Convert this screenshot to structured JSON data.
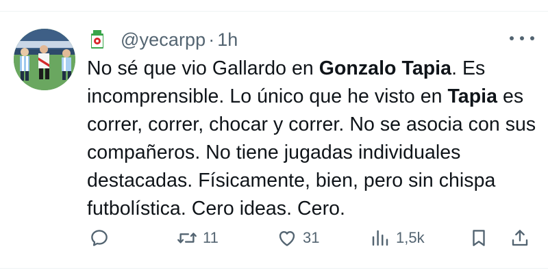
{
  "tweet": {
    "handle": "@yecarpp",
    "separator": "·",
    "time": "1h",
    "text": {
      "p1": "No sé que vio Gallardo en ",
      "b1": "Gonzalo Tapia",
      "p2": ". Es incomprensible. Lo único que he visto en ",
      "b2": "Tapia",
      "p3": " es correr, correr, chocar y correr. No se asocia con sus compañeros. No tiene jugadas individuales destacadas. Físicamente, bien, pero sin chispa futbolística. Cero ideas. Cero."
    }
  },
  "actions": {
    "replies": "",
    "retweets": "11",
    "likes": "31",
    "views": "1,5k"
  },
  "colors": {
    "text": "#0f1419",
    "secondary": "#536471",
    "divider": "#eff3f4"
  },
  "icons": [
    "avatar",
    "verified-box-icon",
    "more-icon",
    "reply-icon",
    "retweet-icon",
    "like-icon",
    "views-icon",
    "bookmark-icon",
    "share-icon"
  ]
}
